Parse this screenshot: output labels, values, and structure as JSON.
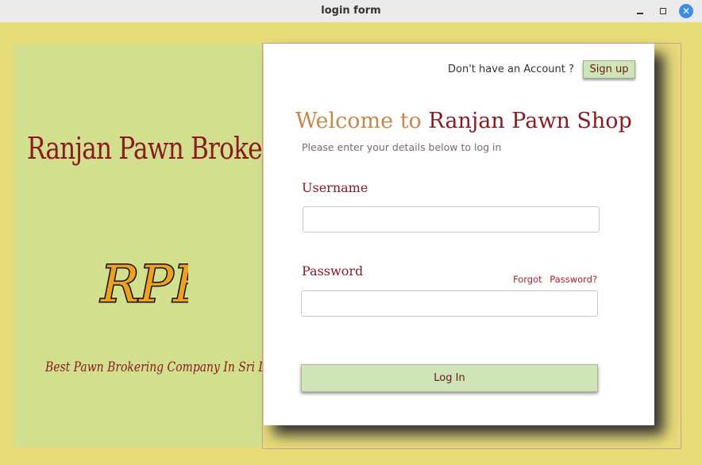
{
  "window": {
    "title": "login form"
  },
  "branding": {
    "company_name": "Ranjan Pawn Brokers",
    "logo_text": "RPB",
    "tagline": "Best Pawn Brokering Company In Sri Lanka"
  },
  "signup": {
    "question": "Don't have an Account ?",
    "button_label": "Sign up"
  },
  "form": {
    "welcome_prefix": "Welcome to",
    "welcome_name": "Ranjan Pawn Shop",
    "subtitle": "Please enter your details below to log in",
    "username_label": "Username",
    "username_value": "",
    "password_label": "Password",
    "password_value": "",
    "forgot_label": "Forgot Password?",
    "login_label": "Log In"
  },
  "colors": {
    "background": "#e8dc78",
    "left_panel": "#d2e08e",
    "brand": "#8b1a22",
    "button": "#cfe5b8",
    "accent": "#c8864a"
  }
}
